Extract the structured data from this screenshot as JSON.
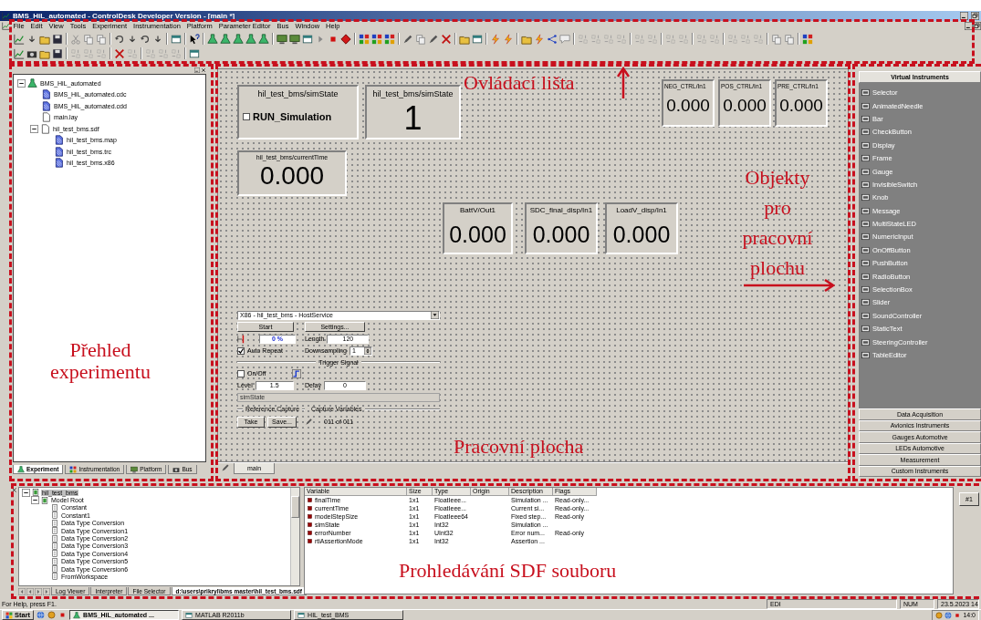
{
  "window": {
    "title": "BMS_HiL_automated - ControlDesk Developer Version - [main *]"
  },
  "menu": [
    "File",
    "Edit",
    "View",
    "Tools",
    "Experiment",
    "Instrumentation",
    "Platform",
    "Parameter Editor",
    "Bus",
    "Window",
    "Help"
  ],
  "experiment_tree": [
    {
      "label": "BMS_HiL_automated",
      "kind": "project",
      "selected": false,
      "expanded": true,
      "children": [
        {
          "label": "BMS_HiL_automated.cdc",
          "kind": "data",
          "selected": false
        },
        {
          "label": "BMS_HiL_automated.cdd",
          "kind": "data",
          "selected": false
        },
        {
          "label": "main.lay",
          "kind": "plain",
          "selected": false
        },
        {
          "label": "hil_test_bms.sdf",
          "kind": "plain",
          "selected": false,
          "expanded": true,
          "children": [
            {
              "label": "hil_test_bms.map",
              "kind": "data",
              "selected": false
            },
            {
              "label": "hil_test_bms.trc",
              "kind": "data",
              "selected": false
            },
            {
              "label": "hil_test_bms.x86",
              "kind": "data",
              "selected": false
            }
          ]
        }
      ]
    }
  ],
  "left_tabs": [
    {
      "label": "Experiment",
      "selected": true
    },
    {
      "label": "Instrumentation",
      "selected": false
    },
    {
      "label": "Platform",
      "selected": false
    },
    {
      "label": "Bus",
      "selected": false
    }
  ],
  "layout": {
    "instruments": [
      {
        "kind": "checkbutton",
        "title": "hil_test_bms/simState",
        "label": "RUN_Simulation",
        "checked": false
      },
      {
        "kind": "display",
        "title": "hil_test_bms/simState",
        "value": "1"
      },
      {
        "kind": "display",
        "title": "hil_test_bms/currentTime",
        "value": "0.000"
      },
      {
        "kind": "display",
        "title": "NEG_CTRL/In1",
        "value": "0.000"
      },
      {
        "kind": "display",
        "title": "POS_CTRL/In1",
        "value": "0.000"
      },
      {
        "kind": "display",
        "title": "PRE_CTRL/In1",
        "value": "0.000"
      },
      {
        "kind": "display",
        "title": "BattV/Out1",
        "value": "0.000"
      },
      {
        "kind": "display",
        "title": "SDC_final_disp/In1",
        "value": "0.000"
      },
      {
        "kind": "display",
        "title": "LoadV_disp/In1",
        "value": "0.000"
      }
    ],
    "capture": {
      "platform": "X86 - hil_test_bms - HostService",
      "start": "Start",
      "settings": "Settings...",
      "progress": "0 %",
      "length_label": "Length",
      "length": "120",
      "auto_repeat": {
        "label": "Auto Repeat",
        "checked": true
      },
      "downsampling_label": "Downsampling",
      "downsampling": "1",
      "trigger_group": "Trigger Signal",
      "trigger_on": {
        "label": "On/Off",
        "checked": false
      },
      "level_label": "Level",
      "level_value": "1.5",
      "delay_label": "Delay",
      "delay": "0",
      "trigger_variable": "simState",
      "reference_group": "Reference Capture",
      "take": "Take",
      "save": "Save...",
      "variables_group": "Capture Variables",
      "variables_count": "011 of 011"
    },
    "tabs": [
      {
        "label": "main",
        "selected": true
      }
    ]
  },
  "instrument_selector": [
    {
      "label": "Virtual Instruments",
      "expanded": true,
      "items": [
        "Selector",
        "AnimatedNeedle",
        "Bar",
        "CheckButton",
        "Display",
        "Frame",
        "Gauge",
        "InvisibleSwitch",
        "Knob",
        "Message",
        "MultiStateLED",
        "NumericInput",
        "OnOffButton",
        "PushButton",
        "RadioButton",
        "SelectionBox",
        "Slider",
        "SoundController",
        "StaticText",
        "SteeringController",
        "TableEditor"
      ]
    },
    {
      "label": "Data Acquisition",
      "expanded": false
    },
    {
      "label": "Avionics Instruments",
      "expanded": false
    },
    {
      "label": "Gauges Automotive",
      "expanded": false
    },
    {
      "label": "LEDs Automotive",
      "expanded": false
    },
    {
      "label": "Measurement",
      "expanded": false
    },
    {
      "label": "Custom Instruments",
      "expanded": false
    }
  ],
  "sdf_tree": [
    {
      "label": "hil_test_bms",
      "kind": "model",
      "selected": true,
      "expanded": true,
      "children": [
        {
          "label": "Model Root",
          "kind": "model",
          "selected": false,
          "expanded": true,
          "children": [
            {
              "label": "Constant",
              "kind": "block",
              "selected": false
            },
            {
              "label": "Constant1",
              "kind": "block",
              "selected": false
            },
            {
              "label": "Data Type Conversion",
              "kind": "block",
              "selected": false
            },
            {
              "label": "Data Type Conversion1",
              "kind": "block",
              "selected": false
            },
            {
              "label": "Data Type Conversion2",
              "kind": "block",
              "selected": false
            },
            {
              "label": "Data Type Conversion3",
              "kind": "block",
              "selected": false
            },
            {
              "label": "Data Type Conversion4",
              "kind": "block",
              "selected": false
            },
            {
              "label": "Data Type Conversion5",
              "kind": "block",
              "selected": false
            },
            {
              "label": "Data Type Conversion6",
              "kind": "block",
              "selected": false
            },
            {
              "label": "FromWorkspace",
              "kind": "block",
              "selected": false
            }
          ]
        }
      ]
    }
  ],
  "bottom_tabs": [
    {
      "label": "Log Viewer",
      "selected": false
    },
    {
      "label": "Interpreter",
      "selected": false
    },
    {
      "label": "File Selector",
      "selected": false
    },
    {
      "label": "d:\\users\\prikryl\\bms master\\hil_test_bms.sdf",
      "selected": true
    }
  ],
  "variable_table": {
    "columns": [
      "Variable",
      "Size",
      "Type",
      "Origin",
      "Description",
      "Flags"
    ],
    "rows": [
      {
        "variable": "finalTime",
        "size": "1x1",
        "type": "FloatIeee...",
        "description": "Simulation ...",
        "flags": "Read-only..."
      },
      {
        "variable": "currentTime",
        "size": "1x1",
        "type": "FloatIeee...",
        "description": "Current si...",
        "flags": "Read-only..."
      },
      {
        "variable": "modelStepSize",
        "size": "1x1",
        "type": "FloatIeee64",
        "description": "Fixed step...",
        "flags": "Read-only"
      },
      {
        "variable": "simState",
        "size": "1x1",
        "type": "Int32",
        "description": "Simulation ..."
      },
      {
        "variable": "errorNumber",
        "size": "1x1",
        "type": "UInt32",
        "description": "Error num...",
        "flags": "Read-only"
      },
      {
        "variable": "rtiAssertionMode",
        "size": "1x1",
        "type": "Int32",
        "description": "Assertion ..."
      }
    ]
  },
  "side_button": "#1",
  "status_bar": {
    "message": "For Help, press F1.",
    "panels": [
      "EDI",
      "NUM",
      "23.5.2023 14"
    ]
  },
  "taskbar": {
    "start": "Start",
    "tasks": [
      {
        "label": "BMS_HiL_automated ...",
        "selected": true
      },
      {
        "label": "MATLAB R2011b",
        "selected": false
      },
      {
        "label": "HIL_test_BMS",
        "selected": false
      }
    ],
    "clock": "14:0"
  },
  "annotations": [
    {
      "kind": "toolbar",
      "text": "Ovládací lišta"
    },
    {
      "kind": "objects",
      "text": "Objekty pro pracovní plochu"
    },
    {
      "kind": "experiment",
      "text": "Přehled experimentu"
    },
    {
      "kind": "workspace",
      "text": "Pracovní plocha"
    },
    {
      "kind": "sdf",
      "text": "Prohledávání SDF souboru"
    }
  ]
}
